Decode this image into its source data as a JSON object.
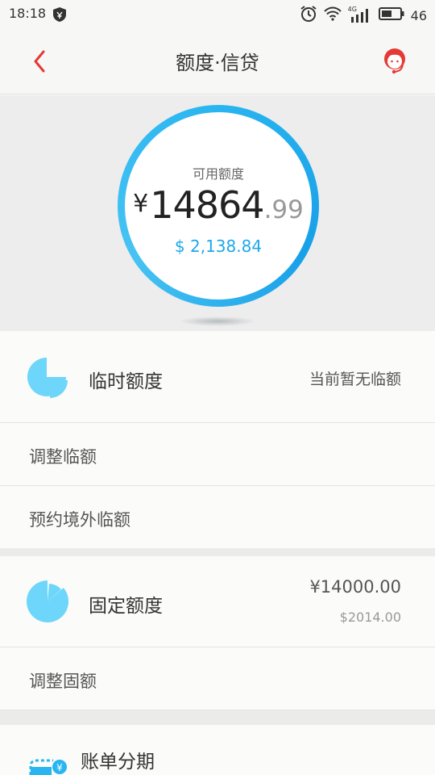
{
  "status_bar": {
    "time": "18:18",
    "battery_level": "46",
    "network_label": "4G"
  },
  "header": {
    "title": "额度·信贷",
    "accent_color": "#e53935"
  },
  "credit": {
    "label": "可用额度",
    "currency_symbol": "¥",
    "amount_integer": "14864",
    "amount_decimal": ".99",
    "usd_amount": "$ 2,138.84",
    "ring_color": "#29b5f0"
  },
  "temporary_limit": {
    "label": "临时额度",
    "status": "当前暂无临额",
    "actions": [
      "调整临额",
      "预约境外临额"
    ]
  },
  "fixed_limit": {
    "label": "固定额度",
    "amount_cny": "¥14000.00",
    "amount_usd": "$2014.00",
    "actions": [
      "调整固额"
    ]
  },
  "installment": {
    "label": "账单分期"
  }
}
